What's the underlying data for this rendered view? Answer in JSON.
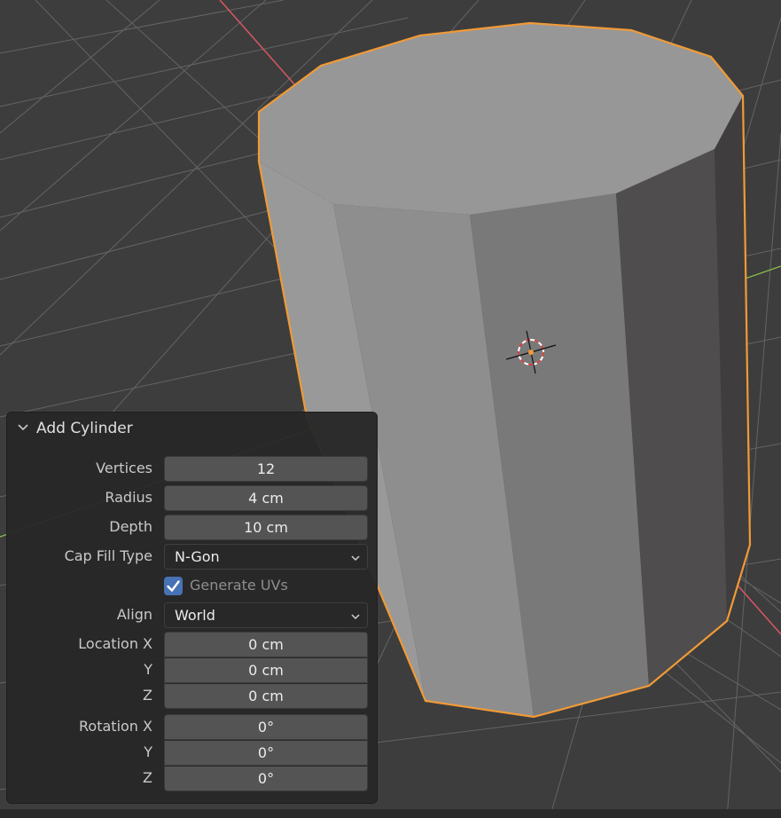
{
  "viewport": {
    "grid_color": "#6b6b6b",
    "x_axis_color": "#d95763",
    "y_axis_color": "#8bc34a",
    "selection_outline_color": "#f09a37",
    "cylinder_colors": [
      "#999999",
      "#8e8e8e",
      "#797979",
      "#4f4d4d",
      "#3f3d3d"
    ]
  },
  "panel": {
    "title": "Add Cylinder",
    "vertices": {
      "label": "Vertices",
      "value": "12"
    },
    "radius": {
      "label": "Radius",
      "value": "4 cm"
    },
    "depth": {
      "label": "Depth",
      "value": "10 cm"
    },
    "cap_fill_type": {
      "label": "Cap Fill Type",
      "value": "N-Gon"
    },
    "generate_uvs": {
      "label": "Generate UVs",
      "checked": true
    },
    "align": {
      "label": "Align",
      "value": "World"
    },
    "location": {
      "x": {
        "label": "Location X",
        "value": "0 cm"
      },
      "y": {
        "label": "Y",
        "value": "0 cm"
      },
      "z": {
        "label": "Z",
        "value": "0 cm"
      }
    },
    "rotation": {
      "x": {
        "label": "Rotation X",
        "value": "0°"
      },
      "y": {
        "label": "Y",
        "value": "0°"
      },
      "z": {
        "label": "Z",
        "value": "0°"
      }
    }
  }
}
